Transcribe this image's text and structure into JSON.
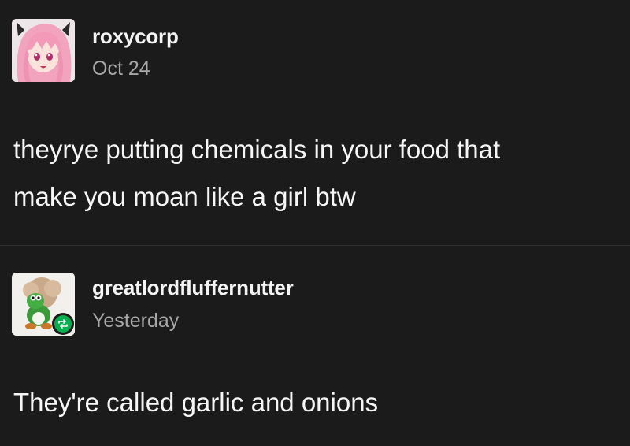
{
  "posts": [
    {
      "username": "roxycorp",
      "timestamp": "Oct 24",
      "lines": [
        "theyrye putting chemicals in your food that",
        "make you moan like a girl btw"
      ],
      "avatar_icon": "anime-girl-avatar"
    },
    {
      "username": "greatlordfluffernutter",
      "timestamp": "Yesterday",
      "lines": [
        "They're called garlic and onions"
      ],
      "avatar_icon": "yoshi-avatar",
      "badge_icon": "reblog-icon",
      "badge_color": "#00b04f"
    }
  ],
  "colors": {
    "background": "#1b1b1b",
    "text": "#f6f6f6",
    "muted": "#a8a8a8"
  }
}
